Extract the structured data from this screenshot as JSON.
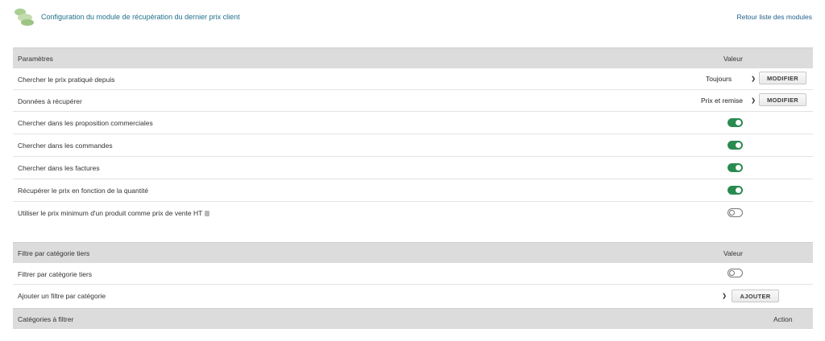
{
  "header": {
    "title": "Configuration du module de récupération du dernier prix client",
    "back_link": "Retour liste des modules",
    "logo_icon": "module-logo-icon"
  },
  "params_table": {
    "col_label": "Paramètres",
    "col_value": "Valeur",
    "rows": [
      {
        "label": "Chercher le prix pratiqué depuis",
        "select_value": "Toujours",
        "button": "MODIFIER"
      },
      {
        "label": "Données à récupérer",
        "select_value": "Prix et remise",
        "button": "MODIFIER"
      },
      {
        "label": "Chercher dans les proposition commerciales",
        "toggle": "on"
      },
      {
        "label": "Chercher dans les commandes",
        "toggle": "on"
      },
      {
        "label": "Chercher dans les factures",
        "toggle": "on"
      },
      {
        "label": "Récupérer le prix en fonction de la quantité",
        "toggle": "on"
      },
      {
        "label": "Utiliser le prix minimum d'un produit comme prix de vente HT",
        "toggle": "off",
        "info_icon": "info-icon"
      }
    ]
  },
  "filter_table": {
    "col_label": "Filtre par catégorie tiers",
    "col_value": "Valeur",
    "rows": [
      {
        "label": "Filtrer par catégorie tiers",
        "toggle": "off"
      },
      {
        "label": "Ajouter un filtre par catégorie",
        "select_value": "",
        "button": "AJOUTER"
      }
    ]
  },
  "categories_table": {
    "col_label": "Catégories à filtrer",
    "col_action": "Action"
  },
  "colors": {
    "accent": "#2a8b50",
    "link": "#1f5f8b",
    "header_bg": "#dcdcdc"
  }
}
